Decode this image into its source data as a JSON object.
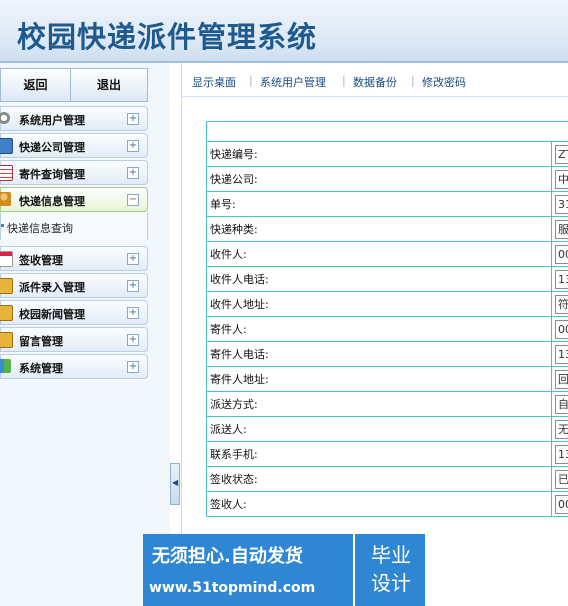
{
  "header": {
    "title": "校园快递派件管理系统"
  },
  "sidebar": {
    "buttons": {
      "back": "返回",
      "logout": "退出"
    },
    "items": [
      {
        "label": "系统用户管理",
        "icon": "gear-icon",
        "toggle": "+"
      },
      {
        "label": "快递公司管理",
        "icon": "monitor-icon",
        "toggle": "+"
      },
      {
        "label": "寄件查询管理",
        "icon": "table-icon",
        "toggle": "+"
      },
      {
        "label": "快递信息管理",
        "icon": "user-icon",
        "toggle": "−"
      },
      {
        "label": "签收管理",
        "icon": "calendar-icon",
        "toggle": "+"
      },
      {
        "label": "派件录入管理",
        "icon": "lock-icon",
        "toggle": "+"
      },
      {
        "label": "校园新闻管理",
        "icon": "lock-icon",
        "toggle": "+"
      },
      {
        "label": "留言管理",
        "icon": "lock-icon",
        "toggle": "+"
      },
      {
        "label": "系统管理",
        "icon": "chart-icon",
        "toggle": "+"
      }
    ],
    "submenu": {
      "label": "快递信息查询"
    },
    "collapse_glyph": "◀"
  },
  "tabs": [
    {
      "label": "显示桌面"
    },
    {
      "label": "系统用户管理"
    },
    {
      "label": "数据备份"
    },
    {
      "label": "修改密码"
    }
  ],
  "tab_separator": "|",
  "form": {
    "rows": [
      {
        "label": "快递编号:",
        "value": "ZT"
      },
      {
        "label": "快递公司:",
        "value": "中"
      },
      {
        "label": "单号:",
        "value": "31"
      },
      {
        "label": "快递种类:",
        "value": "服"
      },
      {
        "label": "收件人:",
        "value": "00"
      },
      {
        "label": "收件人电话:",
        "value": "13"
      },
      {
        "label": "收件人地址:",
        "value": "符"
      },
      {
        "label": "寄件人:",
        "value": "00"
      },
      {
        "label": "寄件人电话:",
        "value": "13"
      },
      {
        "label": "寄件人地址:",
        "value": "回"
      },
      {
        "label": "派送方式:",
        "value": "自"
      },
      {
        "label": "派送人:",
        "value": "无"
      },
      {
        "label": "联系手机:",
        "value": "13"
      },
      {
        "label": "签收状态:",
        "value": "已"
      },
      {
        "label": "签收人:",
        "value": "00"
      }
    ]
  },
  "watermark": {
    "line1": "无须担心.自动发货",
    "line2": "www.51topmind.com",
    "badge": "毕业设计"
  },
  "colors": {
    "title": "#1f5a8f",
    "table_border": "#4bc1c8",
    "watermark_bg": "#2f86d3"
  }
}
